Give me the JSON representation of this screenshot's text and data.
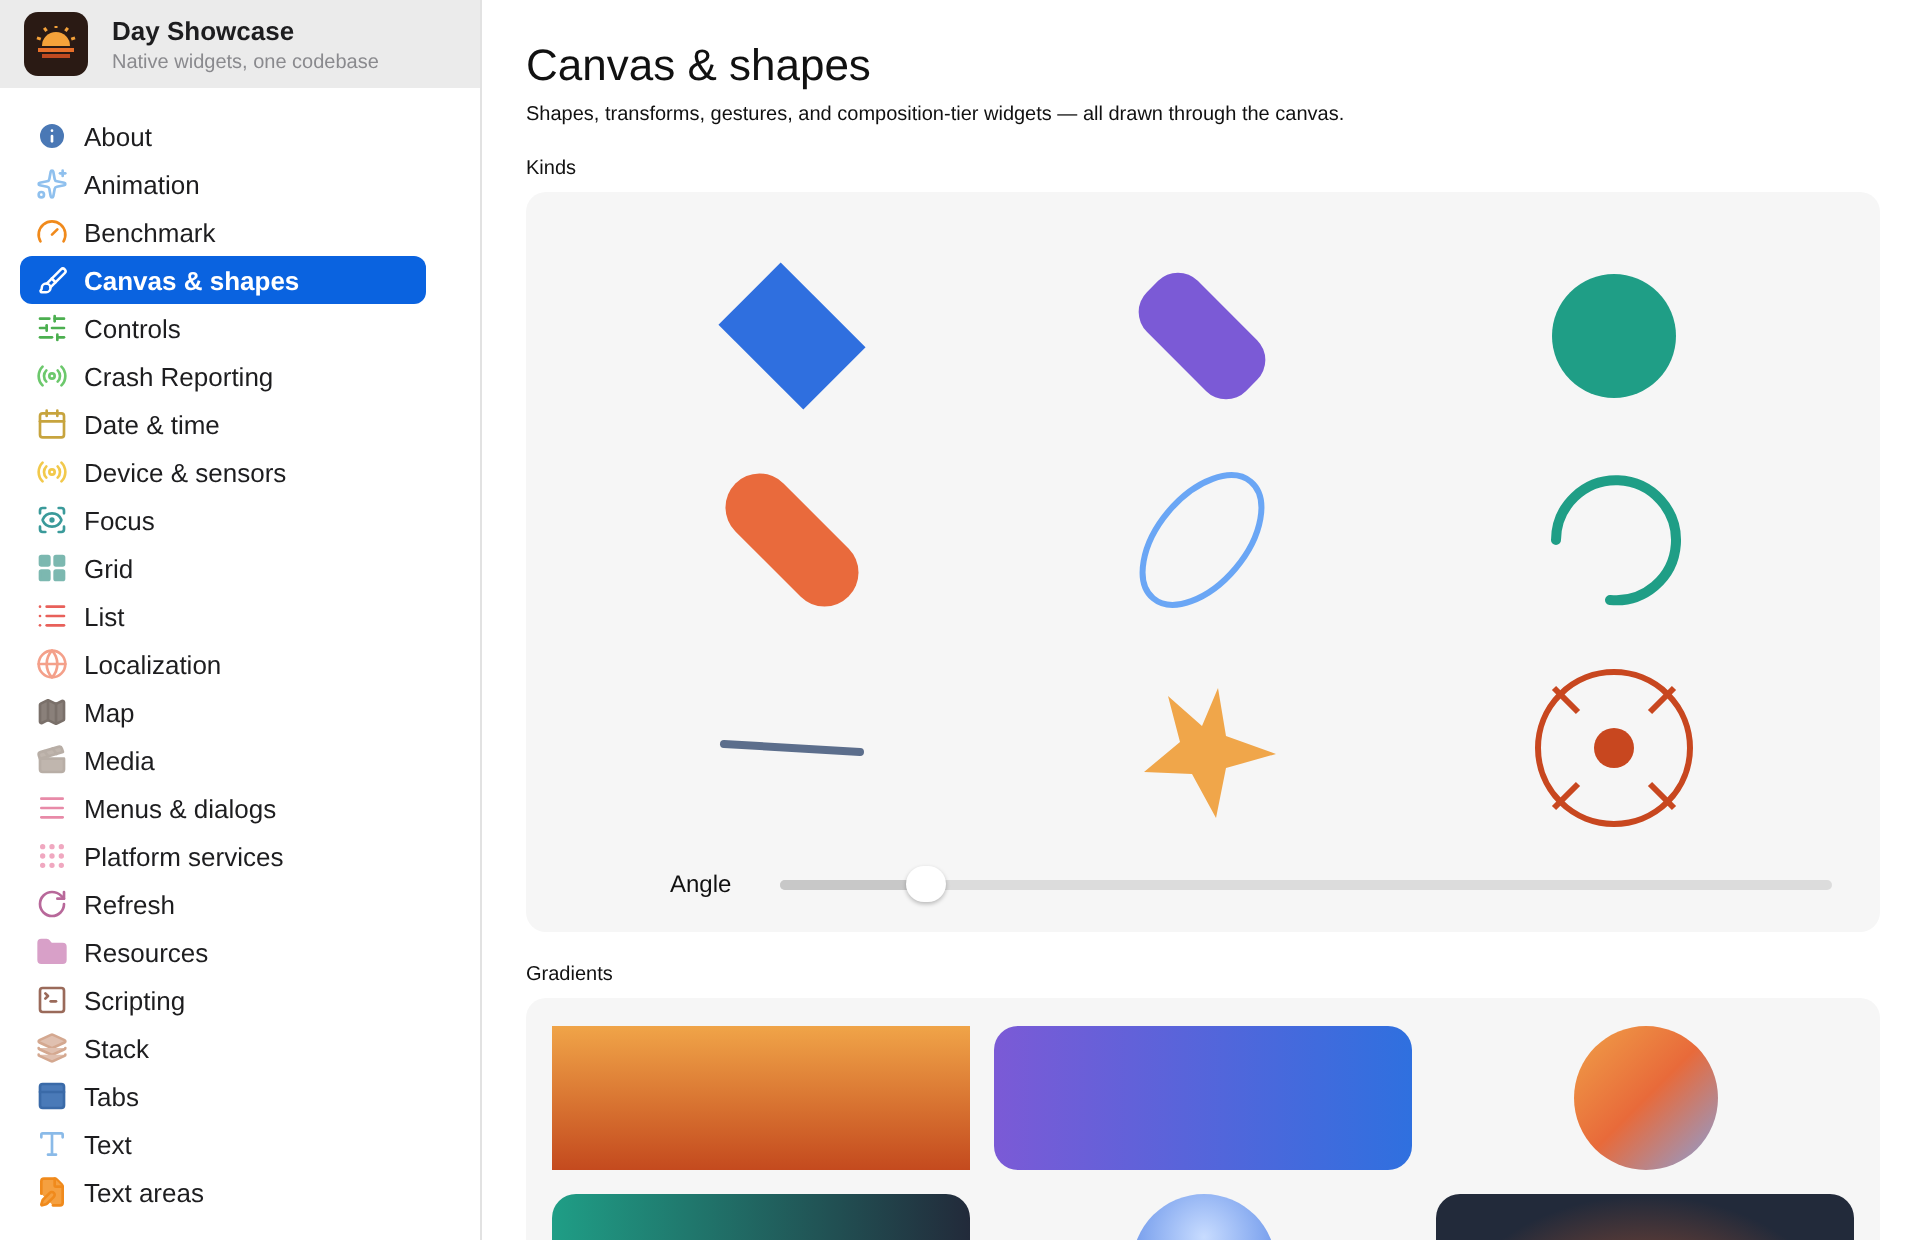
{
  "app": {
    "title": "Day Showcase",
    "subtitle": "Native widgets, one codebase"
  },
  "sidebar": {
    "items": [
      {
        "label": "About",
        "selected": false
      },
      {
        "label": "Animation",
        "selected": false
      },
      {
        "label": "Benchmark",
        "selected": false
      },
      {
        "label": "Canvas & shapes",
        "selected": true
      },
      {
        "label": "Controls",
        "selected": false
      },
      {
        "label": "Crash Reporting",
        "selected": false
      },
      {
        "label": "Date & time",
        "selected": false
      },
      {
        "label": "Device & sensors",
        "selected": false
      },
      {
        "label": "Focus",
        "selected": false
      },
      {
        "label": "Grid",
        "selected": false
      },
      {
        "label": "List",
        "selected": false
      },
      {
        "label": "Localization",
        "selected": false
      },
      {
        "label": "Map",
        "selected": false
      },
      {
        "label": "Media",
        "selected": false
      },
      {
        "label": "Menus & dialogs",
        "selected": false
      },
      {
        "label": "Platform services",
        "selected": false
      },
      {
        "label": "Refresh",
        "selected": false
      },
      {
        "label": "Resources",
        "selected": false
      },
      {
        "label": "Scripting",
        "selected": false
      },
      {
        "label": "Stack",
        "selected": false
      },
      {
        "label": "Tabs",
        "selected": false
      },
      {
        "label": "Text",
        "selected": false
      },
      {
        "label": "Text areas",
        "selected": false
      }
    ]
  },
  "page": {
    "title": "Canvas & shapes",
    "subtitle": "Shapes, transforms, gestures, and composition-tier widgets — all drawn through the canvas."
  },
  "kinds": {
    "heading": "Kinds",
    "shapes": [
      {
        "kind": "rect",
        "color": "#2f6fdf"
      },
      {
        "kind": "rounded",
        "color": "#7b5ad6"
      },
      {
        "kind": "circle",
        "color": "#1f9e86"
      },
      {
        "kind": "capsule",
        "color": "#e96a3c"
      },
      {
        "kind": "ellipse",
        "color": "#6aa6f5"
      },
      {
        "kind": "arc",
        "color": "#1f9e86"
      },
      {
        "kind": "line",
        "color": "#5c6e8c"
      },
      {
        "kind": "star",
        "color": "#f0a64a"
      },
      {
        "kind": "target",
        "color": "#c8471f"
      }
    ],
    "slider": {
      "label": "Angle",
      "level": 0.14
    }
  },
  "gradients": {
    "heading": "Gradients"
  }
}
